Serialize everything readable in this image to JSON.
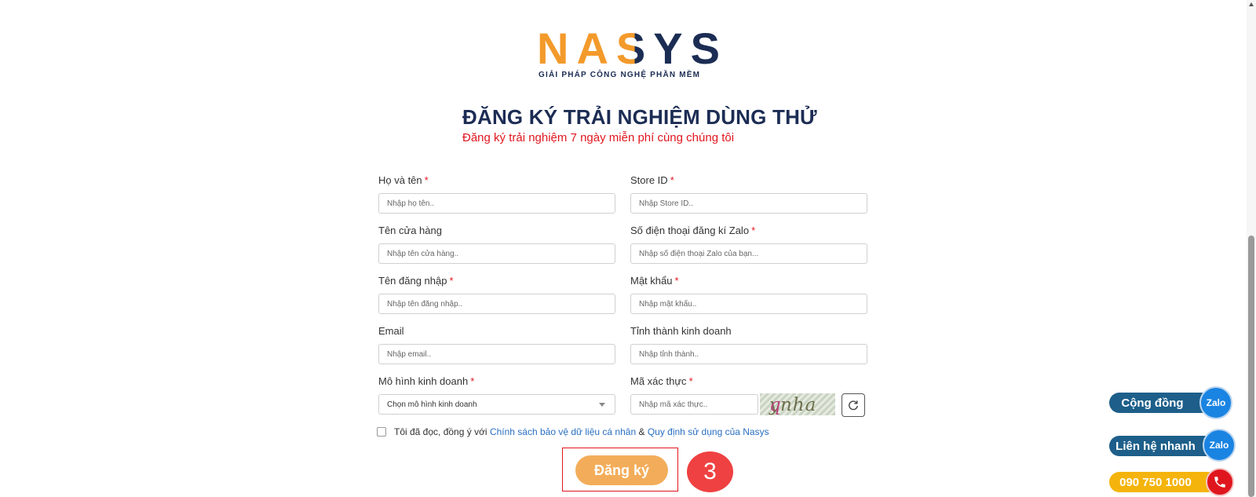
{
  "brand": {
    "logo_part1": "NA",
    "logo_part2": "S",
    "logo_part3": "YS",
    "tagline": "GIẢI PHÁP CÔNG NGHỆ PHẦN MỀM",
    "color_orange": "#f39a2b",
    "color_navy": "#1c2d54"
  },
  "header": {
    "title": "ĐĂNG KÝ TRẢI NGHIỆM DÙNG THỬ",
    "subtitle": "Đăng ký trải nghiệm 7 ngày miễn phí cùng chúng tôi"
  },
  "form": {
    "required_mark": "*",
    "full_name": {
      "label": "Họ và tên",
      "placeholder": "Nhập họ tên.."
    },
    "store_id": {
      "label": "Store ID",
      "placeholder": "Nhập Store ID.."
    },
    "store_name": {
      "label": "Tên cửa hàng",
      "placeholder": "Nhập tên cửa hàng.."
    },
    "zalo_phone": {
      "label": "Số điện thoại đăng kí Zalo",
      "placeholder": "Nhập số điện thoại Zalo của bạn..."
    },
    "username": {
      "label": "Tên đăng nhập",
      "placeholder": "Nhập tên đăng nhập.."
    },
    "password": {
      "label": "Mật khẩu",
      "placeholder": "Nhập mật khẩu.."
    },
    "email": {
      "label": "Email",
      "placeholder": "Nhập email.."
    },
    "province": {
      "label": "Tỉnh thành kinh doanh",
      "placeholder": "Nhập tỉnh thành.."
    },
    "business_model": {
      "label": "Mô hình kinh doanh",
      "selected": "Chọn mô hình kinh doanh"
    },
    "captcha": {
      "label": "Mã xác thực",
      "placeholder": "Nhập mã xác thực..",
      "image_text_a": "ynha",
      "image_text_b": "q",
      "refresh_icon": "refresh-icon"
    },
    "agree": {
      "prefix": "Tôi đã đọc, đồng ý với",
      "link_privacy": "Chính sách bảo vệ dữ liệu cá nhân",
      "ampersand": "&",
      "link_terms": "Quy định sử dụng của Nasys"
    },
    "submit_label": "Đăng ký",
    "step_badge": "3",
    "highlight_color": "#e0161e",
    "submit_color": "#f3ad5a"
  },
  "floating": {
    "community": {
      "label": "Cộng đồng",
      "icon_text": "Zalo",
      "color": "#1d5f8a"
    },
    "quick_contact": {
      "label": "Liên hệ nhanh",
      "icon_text": "Zalo",
      "color": "#1d5f8a"
    },
    "hotline": {
      "label": "090 750 1000",
      "icon": "phone-icon",
      "color": "#f5b40b"
    }
  }
}
